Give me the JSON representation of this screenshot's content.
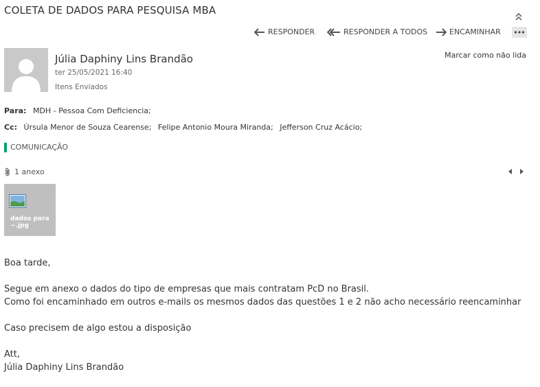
{
  "email": {
    "subject": "COLETA DE DADOS PARA PESQUISA MBA",
    "sender": "Júlia Daphiny Lins Brandão",
    "date": "ter 25/05/2021 16:40",
    "folder": "Itens Enviados",
    "mark_unread": "Marcar como não lida"
  },
  "toolbar": {
    "reply": "RESPONDER",
    "reply_all": "RESPONDER A TODOS",
    "forward": "ENCAMINHAR"
  },
  "recipients": {
    "to_label": "Para:",
    "to": [
      "MDH - Pessoa Com Deficiencia;"
    ],
    "cc_label": "Cc:",
    "cc": [
      "Úrsula Menor de Souza Cearense;",
      "Felipe Antonio Moura Miranda;",
      "Jefferson Cruz Acácio;"
    ]
  },
  "category": {
    "label": "COMUNICAÇÃO",
    "color": "#00a36c"
  },
  "attachments": {
    "count_label": "1 anexo",
    "files": [
      {
        "name_line1": "dados para",
        "name_line2": "~.jpg"
      }
    ]
  },
  "body": {
    "greeting": "Boa tarde,",
    "line1": "Segue em anexo o dados do tipo de empresas que mais contratam PcD no Brasil.",
    "line2": "Como foi encaminhado em outros e-mails os mesmos dados das questões 1 e 2 não acho necessário reencaminhar",
    "line3": "Caso precisem de algo estou a disposição",
    "closing": "Att,",
    "signature": "Júlia Daphiny Lins Brandão"
  }
}
